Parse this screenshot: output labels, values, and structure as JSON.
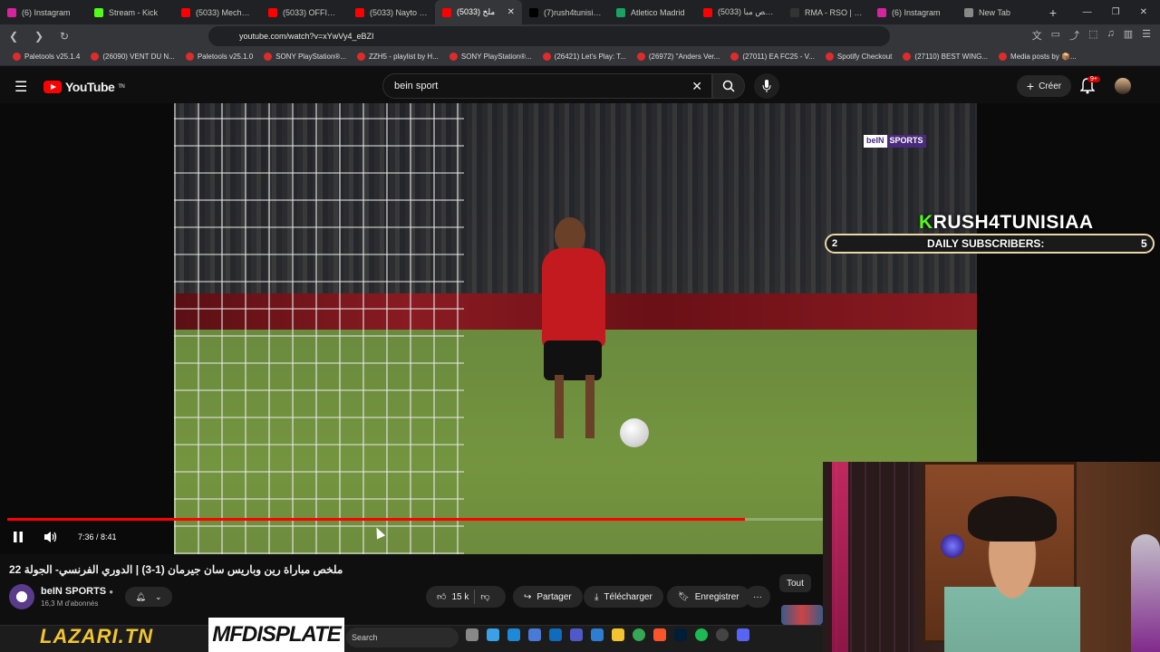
{
  "browser": {
    "tabs": [
      {
        "title": "(6) Instagram",
        "color": "#d6249f"
      },
      {
        "title": "Stream - Kick",
        "color": "#53fc18"
      },
      {
        "title": "(5033) Mechatni",
        "color": "#ff0000"
      },
      {
        "title": "(5033) OFFICIAL",
        "color": "#ff0000"
      },
      {
        "title": "(5033) Nayto - B",
        "color": "#ff0000"
      },
      {
        "title": "(5033) ملخ",
        "color": "#ff0000",
        "active": true
      },
      {
        "title": "(7)rush4tunisiaa",
        "color": "#000000"
      },
      {
        "title": "Atletico Madrid",
        "color": "#1aa260"
      },
      {
        "title": "ملخص مبا (5033)",
        "color": "#ff0000"
      },
      {
        "title": "RMA - RSO | Real",
        "color": "#333333"
      },
      {
        "title": "(6) Instagram",
        "color": "#d6249f"
      },
      {
        "title": "New Tab",
        "color": "#888888"
      }
    ],
    "new_tab_symbol": "+",
    "url": "youtube.com/watch?v=xYwVy4_eBZI",
    "bookmarks": [
      "Paletools v25.1.4",
      "(26090) VENT DU N...",
      "Paletools v25.1.0",
      "SONY PlayStation®...",
      "ZZH5 - playlist by H...",
      "SONY PlayStation®...",
      "(26421) Let's Play: T...",
      "(26972) \"Anders Ver...",
      "(27011) EA FC25 - V...",
      "Spotify Checkout",
      "(27110) BEST WING...",
      "Media posts by 📦..."
    ]
  },
  "youtube": {
    "logo_text": "YouTube",
    "logo_sup": "TN",
    "search_value": "bein sport",
    "create_label": "Créer",
    "notification_count": "9+"
  },
  "video": {
    "broadcaster_logo_1": "beIN",
    "broadcaster_logo_2": "SPORTS",
    "overlay": {
      "title_k": "K",
      "title_rest": "RUSH4TUNISIAA",
      "label": "DAILY SUBSCRIBERS:",
      "start": "2",
      "goal": "5",
      "progress": 0.0
    },
    "time_current": "7:36",
    "time_total": "8:41",
    "time_display": "7:36 / 8:41",
    "progress_fraction": 0.904,
    "title": "ملخص مباراة رين وباريس سان جيرمان (1-3) | الدوري الفرنسي- الجولة 22",
    "channel_name": "beIN SPORTS",
    "subscribers": "16,3 M d'abonnés",
    "likes": "15 k",
    "share_label": "Partager",
    "download_label": "Télécharger",
    "save_label": "Enregistrer",
    "more_label": "···",
    "chip_label": "Tout"
  },
  "taskbar": {
    "lazari_text": "LAZARI.TN",
    "mfd_text": "MFDISPLATE",
    "search_label": "Search"
  }
}
